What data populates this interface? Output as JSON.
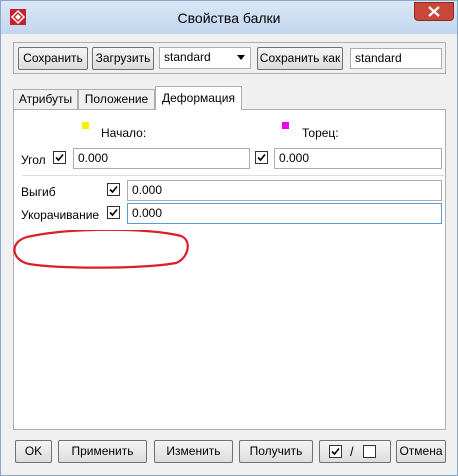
{
  "window": {
    "title": "Свойства балки"
  },
  "icons": {
    "app": "app-logo-icon",
    "close": "close-icon"
  },
  "colors": {
    "start_marker": "#f2f200",
    "end_marker": "#ee00ee",
    "annotation": "#d6202a"
  },
  "toolbar": {
    "save_label": "Сохранить",
    "load_label": "Загрузить",
    "preset_select_value": "standard",
    "save_as_label": "Сохранить как",
    "save_as_value": "standard"
  },
  "tabs": [
    {
      "label": "Атрибуты"
    },
    {
      "label": "Положение"
    },
    {
      "label": "Деформация",
      "active": true
    }
  ],
  "deformation": {
    "start_label": "Начало:",
    "end_label": "Торец:",
    "angle": {
      "label": "Угол",
      "start_checked": true,
      "start_value": "0.000",
      "end_checked": true,
      "end_value": "0.000"
    },
    "bend": {
      "label": "Выгиб",
      "checked": true,
      "value": "0.000"
    },
    "shortening": {
      "label": "Укорачивание",
      "checked": true,
      "value": "0.000"
    }
  },
  "footer": {
    "ok_label": "OK",
    "apply_label": "Применить",
    "modify_label": "Изменить",
    "get_label": "Получить",
    "toggle_separator": "/",
    "cancel_label": "Отмена"
  }
}
